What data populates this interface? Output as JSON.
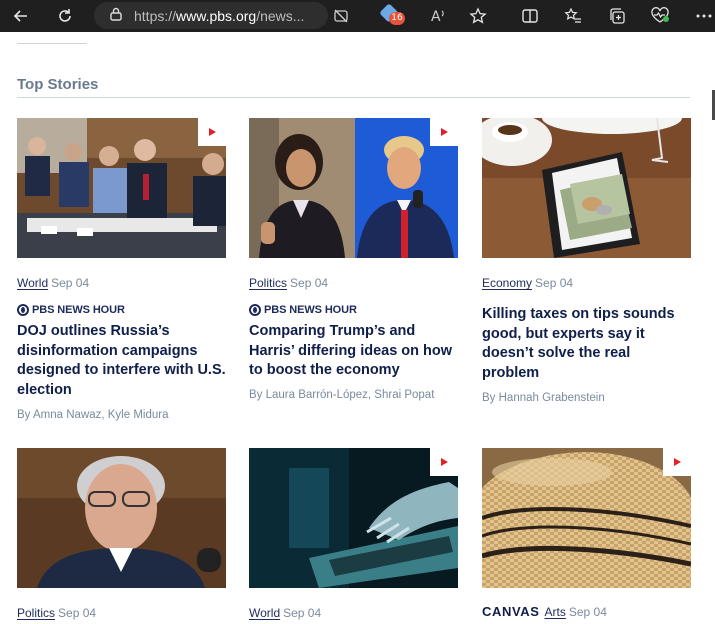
{
  "browser": {
    "url_prefix": "https://",
    "url_domain": "www.pbs.org",
    "url_rest": "/news...",
    "tab_badge_count": "16"
  },
  "section": {
    "title": "Top Stories"
  },
  "cards": [
    {
      "category": "World",
      "date": "Sep 04",
      "show": "PBS NEWS HOUR",
      "headline": "DOJ outlines Russia’s disinformation campaigns designed to interfere with U.S. election",
      "byline": "By Amna Nawaz, Kyle Midura"
    },
    {
      "category": "Politics",
      "date": "Sep 04",
      "show": "PBS NEWS HOUR",
      "headline": "Comparing Trump’s and Harris’ differing ideas on how to boost the economy",
      "byline": "By Laura Barrón-López, Shrai Popat"
    },
    {
      "category": "Economy",
      "date": "Sep 04",
      "headline": "Killing taxes on tips sounds good, but experts say it doesn’t solve the real problem",
      "byline": "By Hannah Grabenstein"
    },
    {
      "category": "Politics",
      "date": "Sep 04"
    },
    {
      "category": "World",
      "date": "Sep 04"
    },
    {
      "brand": "CANVAS",
      "category": "Arts",
      "date": "Sep 04"
    }
  ],
  "colors": {
    "accent": "#1d2a5a",
    "play": "#e0202a",
    "muted": "#7a8a9c"
  }
}
